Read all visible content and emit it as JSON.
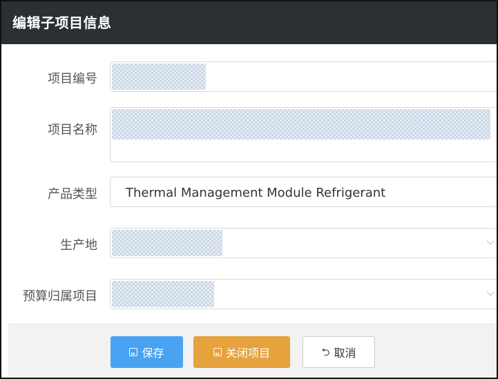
{
  "dialog": {
    "title": "编辑子项目信息"
  },
  "form": {
    "fields": [
      {
        "label": "项目编号",
        "value": ""
      },
      {
        "label": "项目名称",
        "value": ""
      },
      {
        "label": "产品类型",
        "value": "Thermal Management Module Refrigerant"
      },
      {
        "label": "生产地",
        "value": ""
      },
      {
        "label": "预算归属项目",
        "value": ""
      }
    ]
  },
  "footer": {
    "save_label": "保存",
    "close_project_label": "关闭项目",
    "cancel_label": "取消"
  },
  "icons": {
    "save": "save-icon",
    "close_project": "save-icon",
    "cancel": "undo-icon",
    "dropdown": "chevron-down-icon"
  },
  "colors": {
    "titlebar": "#2b3035",
    "save_button": "#4aa3f2",
    "close_button": "#e6a23c"
  }
}
